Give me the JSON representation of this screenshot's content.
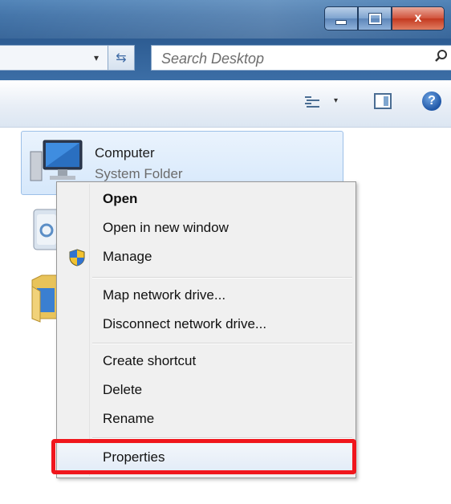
{
  "window": {
    "buttons": {
      "minimize_icon": "minimize-icon",
      "maximize_icon": "maximize-icon",
      "close_label": "x"
    }
  },
  "address_bar": {
    "dropdown_glyph": "▾",
    "refresh_glyph": "⇆"
  },
  "search": {
    "placeholder": "Search Desktop",
    "icon": "search-icon"
  },
  "toolbar": {
    "views_dropdown_glyph": "▾",
    "help_label": "?"
  },
  "desktop_items": [
    {
      "title": "Computer",
      "subtitle": "System Folder",
      "icon": "computer-icon",
      "selected": true
    },
    {
      "icon": "recycle-bin-icon"
    },
    {
      "icon": "folder-icon"
    }
  ],
  "context_menu": {
    "items": [
      {
        "label": "Open",
        "bold": true
      },
      {
        "label": "Open in new window"
      },
      {
        "label": "Manage",
        "icon": "uac-shield-icon"
      },
      {
        "label": "Map network drive..."
      },
      {
        "label": "Disconnect network drive..."
      },
      {
        "label": "Create shortcut"
      },
      {
        "label": "Delete"
      },
      {
        "label": "Rename"
      },
      {
        "label": "Properties",
        "highlighted": true
      }
    ]
  },
  "annotation": {
    "highlight_color": "#f0161c",
    "target": "Properties"
  },
  "colors": {
    "title_bar": "#3b6ea5",
    "selection_fill": "#d6e8fb",
    "menu_background": "#f0f0f0"
  }
}
